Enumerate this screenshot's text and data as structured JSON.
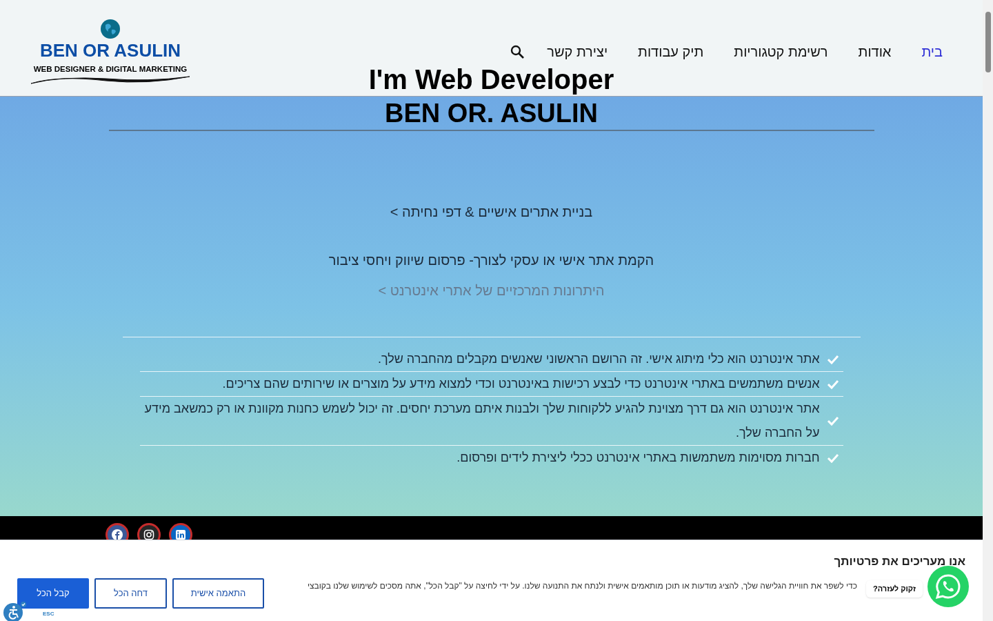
{
  "logo": {
    "title": "BEN OR ASULIN",
    "tagline": "WEB DESIGNER & DIGITAL MARKETING"
  },
  "nav": [
    {
      "label": "בית",
      "selected": true
    },
    {
      "label": "אודות",
      "selected": false
    },
    {
      "label": "רשימת קטגוריות",
      "selected": false
    },
    {
      "label": "תיק עבודות",
      "selected": false
    },
    {
      "label": "יצירת קשר",
      "selected": false
    }
  ],
  "hero": {
    "title": "I'm Web Developer",
    "subtitle": "BEN OR. ASULIN",
    "link_1": "בניית אתרים אישיים & דפי נחיתה >",
    "tagline": "הקמת אתר אישי או עסקי לצורך- פרסום שיווק ויחסי ציבור",
    "link_2": "היתרונות המרכזיים של אתרי אינטרנט >"
  },
  "benefits": [
    "אתר אינטרנט הוא כלי מיתוג אישי. זה הרושם הראשוני שאנשים מקבלים מהחברה שלך.",
    "אנשים משתמשים באתרי אינטרנט כדי לבצע רכישות באינטרנט וכדי למצוא מידע על מוצרים או שירותים שהם צריכים.",
    "אתר אינטרנט הוא גם דרך מצוינת להגיע ללקוחות שלך ולבנות איתם מערכת יחסים. זה יכול לשמש כחנות מקוונת או רק כמשאב מידע על החברה שלך.",
    "חברות מסוימות משתמשות באתרי אינטרנט ככלי ליצירת לידים ופרסום."
  ],
  "cookie_banner": {
    "title": "אנו מעריכים את פרטיותך",
    "text": "כדי לשפר את חוויית הגלישה שלך, להציג מודעות או תוכן מותאמים אישית ולנתח את התנועה שלנו. על ידי לחיצה על \"קבל הכל\", אתה מסכים לשימוש שלנו בקובצי",
    "buttons": [
      {
        "label": "התאמה אישית",
        "kind": "outline"
      },
      {
        "label": "דחה הכל",
        "kind": "outline"
      },
      {
        "label": "קבל הכל",
        "kind": "filled"
      }
    ]
  },
  "accessibility": {
    "hint": "ESC"
  },
  "chat": {
    "bubble": "זקוק לעזרה?"
  }
}
